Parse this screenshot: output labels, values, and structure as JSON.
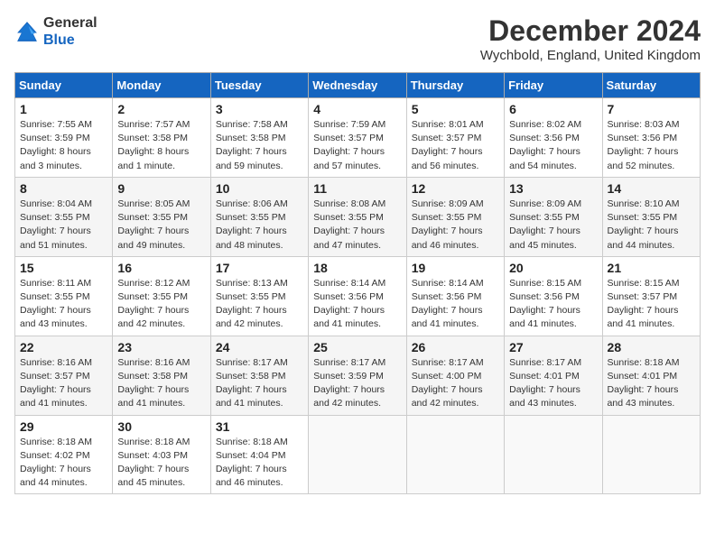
{
  "header": {
    "logo_line1": "General",
    "logo_line2": "Blue",
    "title": "December 2024",
    "subtitle": "Wychbold, England, United Kingdom"
  },
  "columns": [
    "Sunday",
    "Monday",
    "Tuesday",
    "Wednesday",
    "Thursday",
    "Friday",
    "Saturday"
  ],
  "weeks": [
    [
      {
        "day": "1",
        "lines": [
          "Sunrise: 7:55 AM",
          "Sunset: 3:59 PM",
          "Daylight: 8 hours",
          "and 3 minutes."
        ]
      },
      {
        "day": "2",
        "lines": [
          "Sunrise: 7:57 AM",
          "Sunset: 3:58 PM",
          "Daylight: 8 hours",
          "and 1 minute."
        ]
      },
      {
        "day": "3",
        "lines": [
          "Sunrise: 7:58 AM",
          "Sunset: 3:58 PM",
          "Daylight: 7 hours",
          "and 59 minutes."
        ]
      },
      {
        "day": "4",
        "lines": [
          "Sunrise: 7:59 AM",
          "Sunset: 3:57 PM",
          "Daylight: 7 hours",
          "and 57 minutes."
        ]
      },
      {
        "day": "5",
        "lines": [
          "Sunrise: 8:01 AM",
          "Sunset: 3:57 PM",
          "Daylight: 7 hours",
          "and 56 minutes."
        ]
      },
      {
        "day": "6",
        "lines": [
          "Sunrise: 8:02 AM",
          "Sunset: 3:56 PM",
          "Daylight: 7 hours",
          "and 54 minutes."
        ]
      },
      {
        "day": "7",
        "lines": [
          "Sunrise: 8:03 AM",
          "Sunset: 3:56 PM",
          "Daylight: 7 hours",
          "and 52 minutes."
        ]
      }
    ],
    [
      {
        "day": "8",
        "lines": [
          "Sunrise: 8:04 AM",
          "Sunset: 3:55 PM",
          "Daylight: 7 hours",
          "and 51 minutes."
        ]
      },
      {
        "day": "9",
        "lines": [
          "Sunrise: 8:05 AM",
          "Sunset: 3:55 PM",
          "Daylight: 7 hours",
          "and 49 minutes."
        ]
      },
      {
        "day": "10",
        "lines": [
          "Sunrise: 8:06 AM",
          "Sunset: 3:55 PM",
          "Daylight: 7 hours",
          "and 48 minutes."
        ]
      },
      {
        "day": "11",
        "lines": [
          "Sunrise: 8:08 AM",
          "Sunset: 3:55 PM",
          "Daylight: 7 hours",
          "and 47 minutes."
        ]
      },
      {
        "day": "12",
        "lines": [
          "Sunrise: 8:09 AM",
          "Sunset: 3:55 PM",
          "Daylight: 7 hours",
          "and 46 minutes."
        ]
      },
      {
        "day": "13",
        "lines": [
          "Sunrise: 8:09 AM",
          "Sunset: 3:55 PM",
          "Daylight: 7 hours",
          "and 45 minutes."
        ]
      },
      {
        "day": "14",
        "lines": [
          "Sunrise: 8:10 AM",
          "Sunset: 3:55 PM",
          "Daylight: 7 hours",
          "and 44 minutes."
        ]
      }
    ],
    [
      {
        "day": "15",
        "lines": [
          "Sunrise: 8:11 AM",
          "Sunset: 3:55 PM",
          "Daylight: 7 hours",
          "and 43 minutes."
        ]
      },
      {
        "day": "16",
        "lines": [
          "Sunrise: 8:12 AM",
          "Sunset: 3:55 PM",
          "Daylight: 7 hours",
          "and 42 minutes."
        ]
      },
      {
        "day": "17",
        "lines": [
          "Sunrise: 8:13 AM",
          "Sunset: 3:55 PM",
          "Daylight: 7 hours",
          "and 42 minutes."
        ]
      },
      {
        "day": "18",
        "lines": [
          "Sunrise: 8:14 AM",
          "Sunset: 3:56 PM",
          "Daylight: 7 hours",
          "and 41 minutes."
        ]
      },
      {
        "day": "19",
        "lines": [
          "Sunrise: 8:14 AM",
          "Sunset: 3:56 PM",
          "Daylight: 7 hours",
          "and 41 minutes."
        ]
      },
      {
        "day": "20",
        "lines": [
          "Sunrise: 8:15 AM",
          "Sunset: 3:56 PM",
          "Daylight: 7 hours",
          "and 41 minutes."
        ]
      },
      {
        "day": "21",
        "lines": [
          "Sunrise: 8:15 AM",
          "Sunset: 3:57 PM",
          "Daylight: 7 hours",
          "and 41 minutes."
        ]
      }
    ],
    [
      {
        "day": "22",
        "lines": [
          "Sunrise: 8:16 AM",
          "Sunset: 3:57 PM",
          "Daylight: 7 hours",
          "and 41 minutes."
        ]
      },
      {
        "day": "23",
        "lines": [
          "Sunrise: 8:16 AM",
          "Sunset: 3:58 PM",
          "Daylight: 7 hours",
          "and 41 minutes."
        ]
      },
      {
        "day": "24",
        "lines": [
          "Sunrise: 8:17 AM",
          "Sunset: 3:58 PM",
          "Daylight: 7 hours",
          "and 41 minutes."
        ]
      },
      {
        "day": "25",
        "lines": [
          "Sunrise: 8:17 AM",
          "Sunset: 3:59 PM",
          "Daylight: 7 hours",
          "and 42 minutes."
        ]
      },
      {
        "day": "26",
        "lines": [
          "Sunrise: 8:17 AM",
          "Sunset: 4:00 PM",
          "Daylight: 7 hours",
          "and 42 minutes."
        ]
      },
      {
        "day": "27",
        "lines": [
          "Sunrise: 8:17 AM",
          "Sunset: 4:01 PM",
          "Daylight: 7 hours",
          "and 43 minutes."
        ]
      },
      {
        "day": "28",
        "lines": [
          "Sunrise: 8:18 AM",
          "Sunset: 4:01 PM",
          "Daylight: 7 hours",
          "and 43 minutes."
        ]
      }
    ],
    [
      {
        "day": "29",
        "lines": [
          "Sunrise: 8:18 AM",
          "Sunset: 4:02 PM",
          "Daylight: 7 hours",
          "and 44 minutes."
        ]
      },
      {
        "day": "30",
        "lines": [
          "Sunrise: 8:18 AM",
          "Sunset: 4:03 PM",
          "Daylight: 7 hours",
          "and 45 minutes."
        ]
      },
      {
        "day": "31",
        "lines": [
          "Sunrise: 8:18 AM",
          "Sunset: 4:04 PM",
          "Daylight: 7 hours",
          "and 46 minutes."
        ]
      },
      null,
      null,
      null,
      null
    ]
  ]
}
